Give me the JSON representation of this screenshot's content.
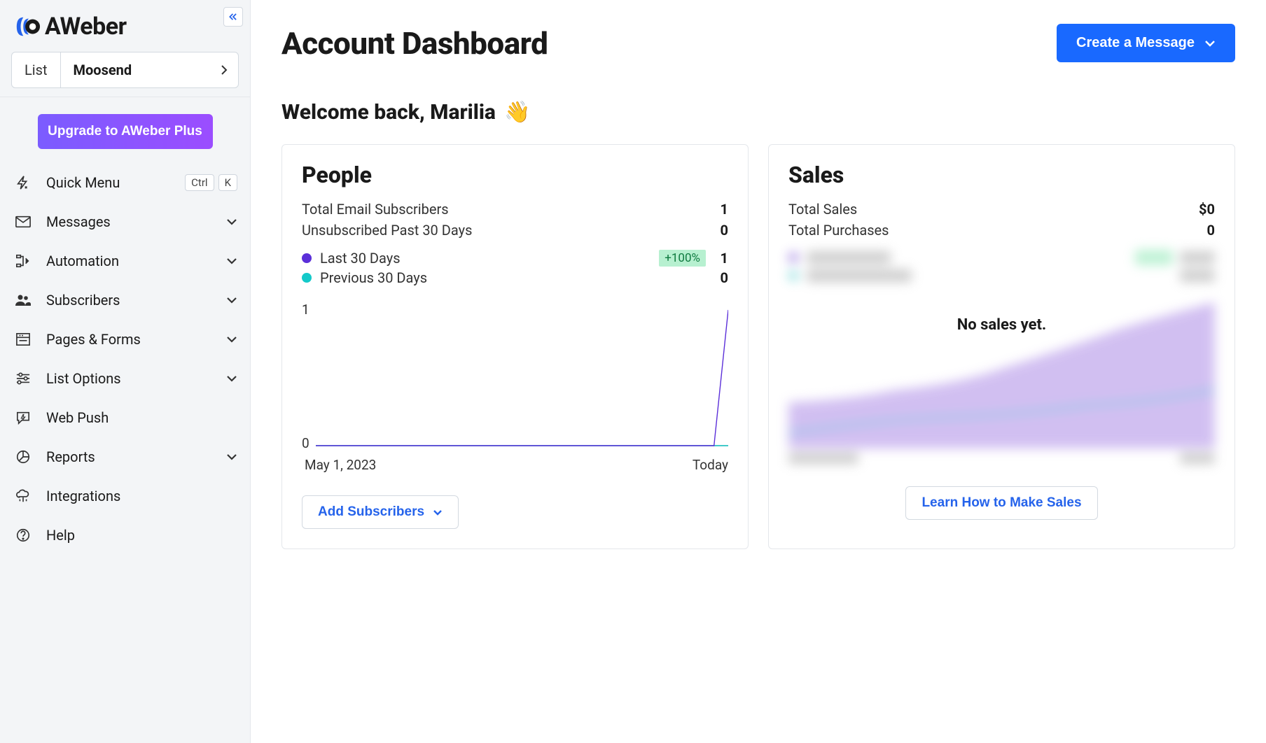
{
  "brand": "AWeber",
  "list_selector": {
    "label": "List",
    "value": "Moosend"
  },
  "upgrade_label": "Upgrade to AWeber Plus",
  "nav": {
    "quick_menu": {
      "label": "Quick Menu",
      "shortcut_ctrl": "Ctrl",
      "shortcut_k": "K"
    },
    "items": [
      {
        "label": "Messages",
        "has_caret": true
      },
      {
        "label": "Automation",
        "has_caret": true
      },
      {
        "label": "Subscribers",
        "has_caret": true
      },
      {
        "label": "Pages & Forms",
        "has_caret": true
      },
      {
        "label": "List Options",
        "has_caret": true
      },
      {
        "label": "Web Push",
        "has_caret": false
      },
      {
        "label": "Reports",
        "has_caret": true
      },
      {
        "label": "Integrations",
        "has_caret": false
      },
      {
        "label": "Help",
        "has_caret": false
      }
    ]
  },
  "header": {
    "title": "Account Dashboard",
    "create_button": "Create a Message"
  },
  "welcome_text": "Welcome back, Marilia",
  "welcome_emoji": "👋",
  "people_card": {
    "title": "People",
    "total_subscribers_label": "Total Email Subscribers",
    "total_subscribers_value": "1",
    "unsubscribed_label": "Unsubscribed Past 30 Days",
    "unsubscribed_value": "0",
    "legend_last30": "Last 30 Days",
    "legend_last30_badge": "+100%",
    "legend_last30_value": "1",
    "legend_prev30": "Previous 30 Days",
    "legend_prev30_value": "0",
    "y_tick_top": "1",
    "y_tick_bottom": "0",
    "x_label_left": "May 1, 2023",
    "x_label_right": "Today",
    "action_label": "Add Subscribers"
  },
  "sales_card": {
    "title": "Sales",
    "total_sales_label": "Total Sales",
    "total_sales_value": "$0",
    "total_purchases_label": "Total Purchases",
    "total_purchases_value": "0",
    "overlay_text": "No sales yet.",
    "action_label": "Learn How to Make Sales"
  },
  "colors": {
    "purple": "#5b2fd9",
    "teal": "#14c9c9",
    "blue": "#1969ff",
    "sales_purple": "#b9a4ea",
    "sales_blue": "#8cc4e8"
  },
  "chart_data": {
    "type": "line",
    "title": "People — Last 30 Days vs Previous 30 Days",
    "xlabel": "",
    "ylabel": "",
    "ylim": [
      0,
      1
    ],
    "x_range": [
      "May 1, 2023",
      "Today"
    ],
    "series": [
      {
        "name": "Last 30 Days",
        "color": "#5b2fd9",
        "values": [
          0,
          0,
          0,
          0,
          0,
          0,
          0,
          0,
          0,
          0,
          0,
          0,
          0,
          0,
          0,
          0,
          0,
          0,
          0,
          0,
          0,
          0,
          0,
          0,
          0,
          0,
          0,
          0,
          0,
          1
        ]
      },
      {
        "name": "Previous 30 Days",
        "color": "#14c9c9",
        "values": [
          0,
          0,
          0,
          0,
          0,
          0,
          0,
          0,
          0,
          0,
          0,
          0,
          0,
          0,
          0,
          0,
          0,
          0,
          0,
          0,
          0,
          0,
          0,
          0,
          0,
          0,
          0,
          0,
          0,
          0
        ]
      }
    ]
  }
}
